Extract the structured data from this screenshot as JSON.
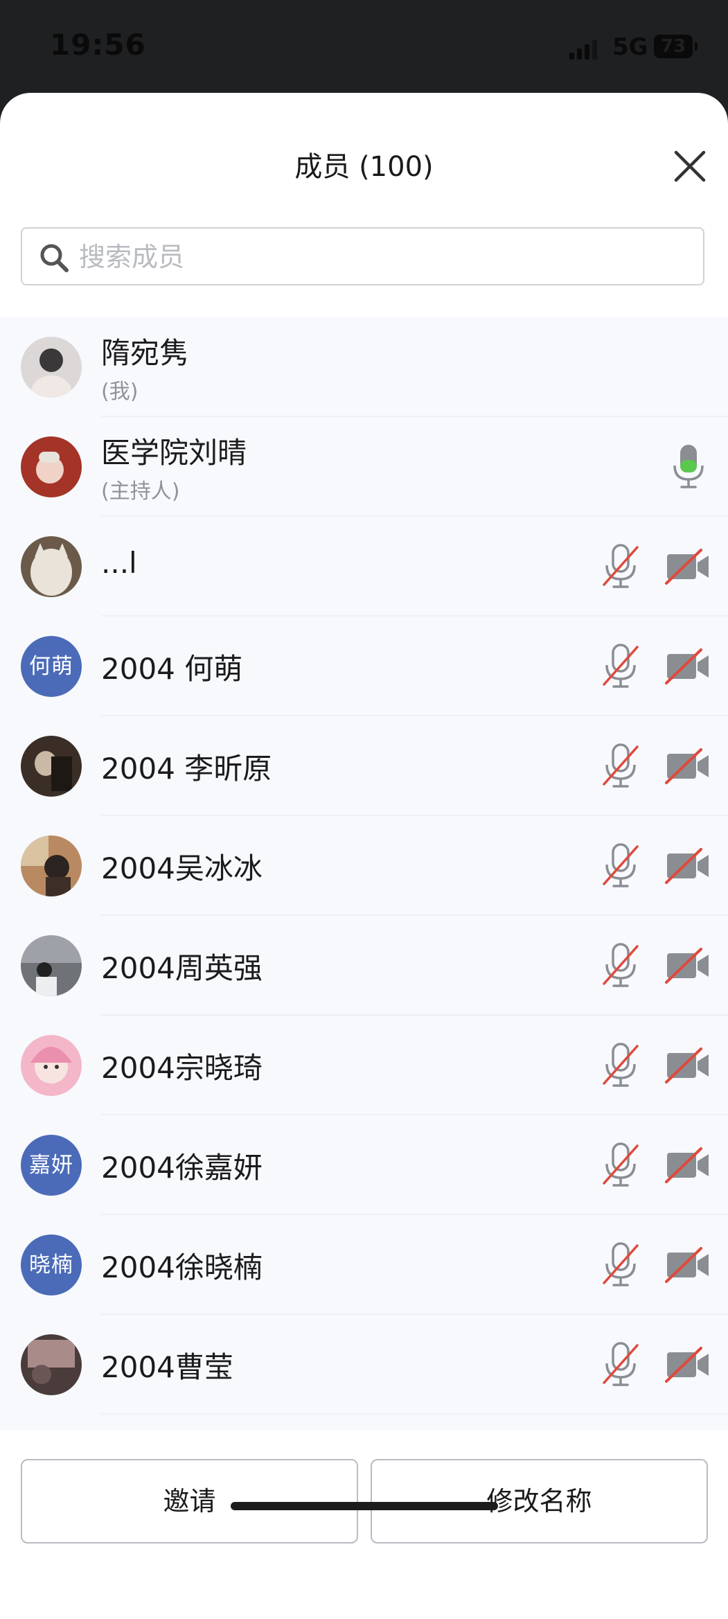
{
  "status_bar": {
    "time": "19:56",
    "network": "5G",
    "battery": "73"
  },
  "header": {
    "title": "成员 (100)"
  },
  "search": {
    "placeholder": "搜索成员"
  },
  "colors": {
    "accent_avatar": "#4b6bb8",
    "mic_active": "#5ac84f",
    "muted_red": "#e0493d"
  },
  "members": [
    {
      "name": "隋宛隽",
      "role": "(我)",
      "avatar_type": "photo"
    },
    {
      "name": "医学院刘晴",
      "role": "(主持人)",
      "avatar_type": "photo",
      "mic": "active"
    },
    {
      "name": "...l",
      "avatar_type": "photo",
      "mic": "muted",
      "camera": "off"
    },
    {
      "name": "2004 何萌",
      "avatar_text": "何萌",
      "mic": "muted",
      "camera": "off"
    },
    {
      "name": "2004 李昕原",
      "avatar_type": "photo",
      "mic": "muted",
      "camera": "off"
    },
    {
      "name": "2004吴冰冰",
      "avatar_type": "photo",
      "mic": "muted",
      "camera": "off"
    },
    {
      "name": "2004周英强",
      "avatar_type": "photo",
      "mic": "muted",
      "camera": "off"
    },
    {
      "name": "2004宗晓琦",
      "avatar_type": "photo",
      "mic": "muted",
      "camera": "off"
    },
    {
      "name": "2004徐嘉妍",
      "avatar_text": "嘉妍",
      "mic": "muted",
      "camera": "off"
    },
    {
      "name": "2004徐晓楠",
      "avatar_text": "晓楠",
      "mic": "muted",
      "camera": "off"
    },
    {
      "name": "2004曹莹",
      "avatar_type": "photo",
      "mic": "muted",
      "camera": "off"
    }
  ],
  "footer": {
    "invite_label": "邀请",
    "rename_label": "修改名称"
  },
  "icons": {
    "close": "close-icon",
    "search": "search-icon",
    "mic_muted": "mic-muted-icon",
    "mic_active": "mic-active-icon",
    "camera_off": "camera-off-icon"
  }
}
